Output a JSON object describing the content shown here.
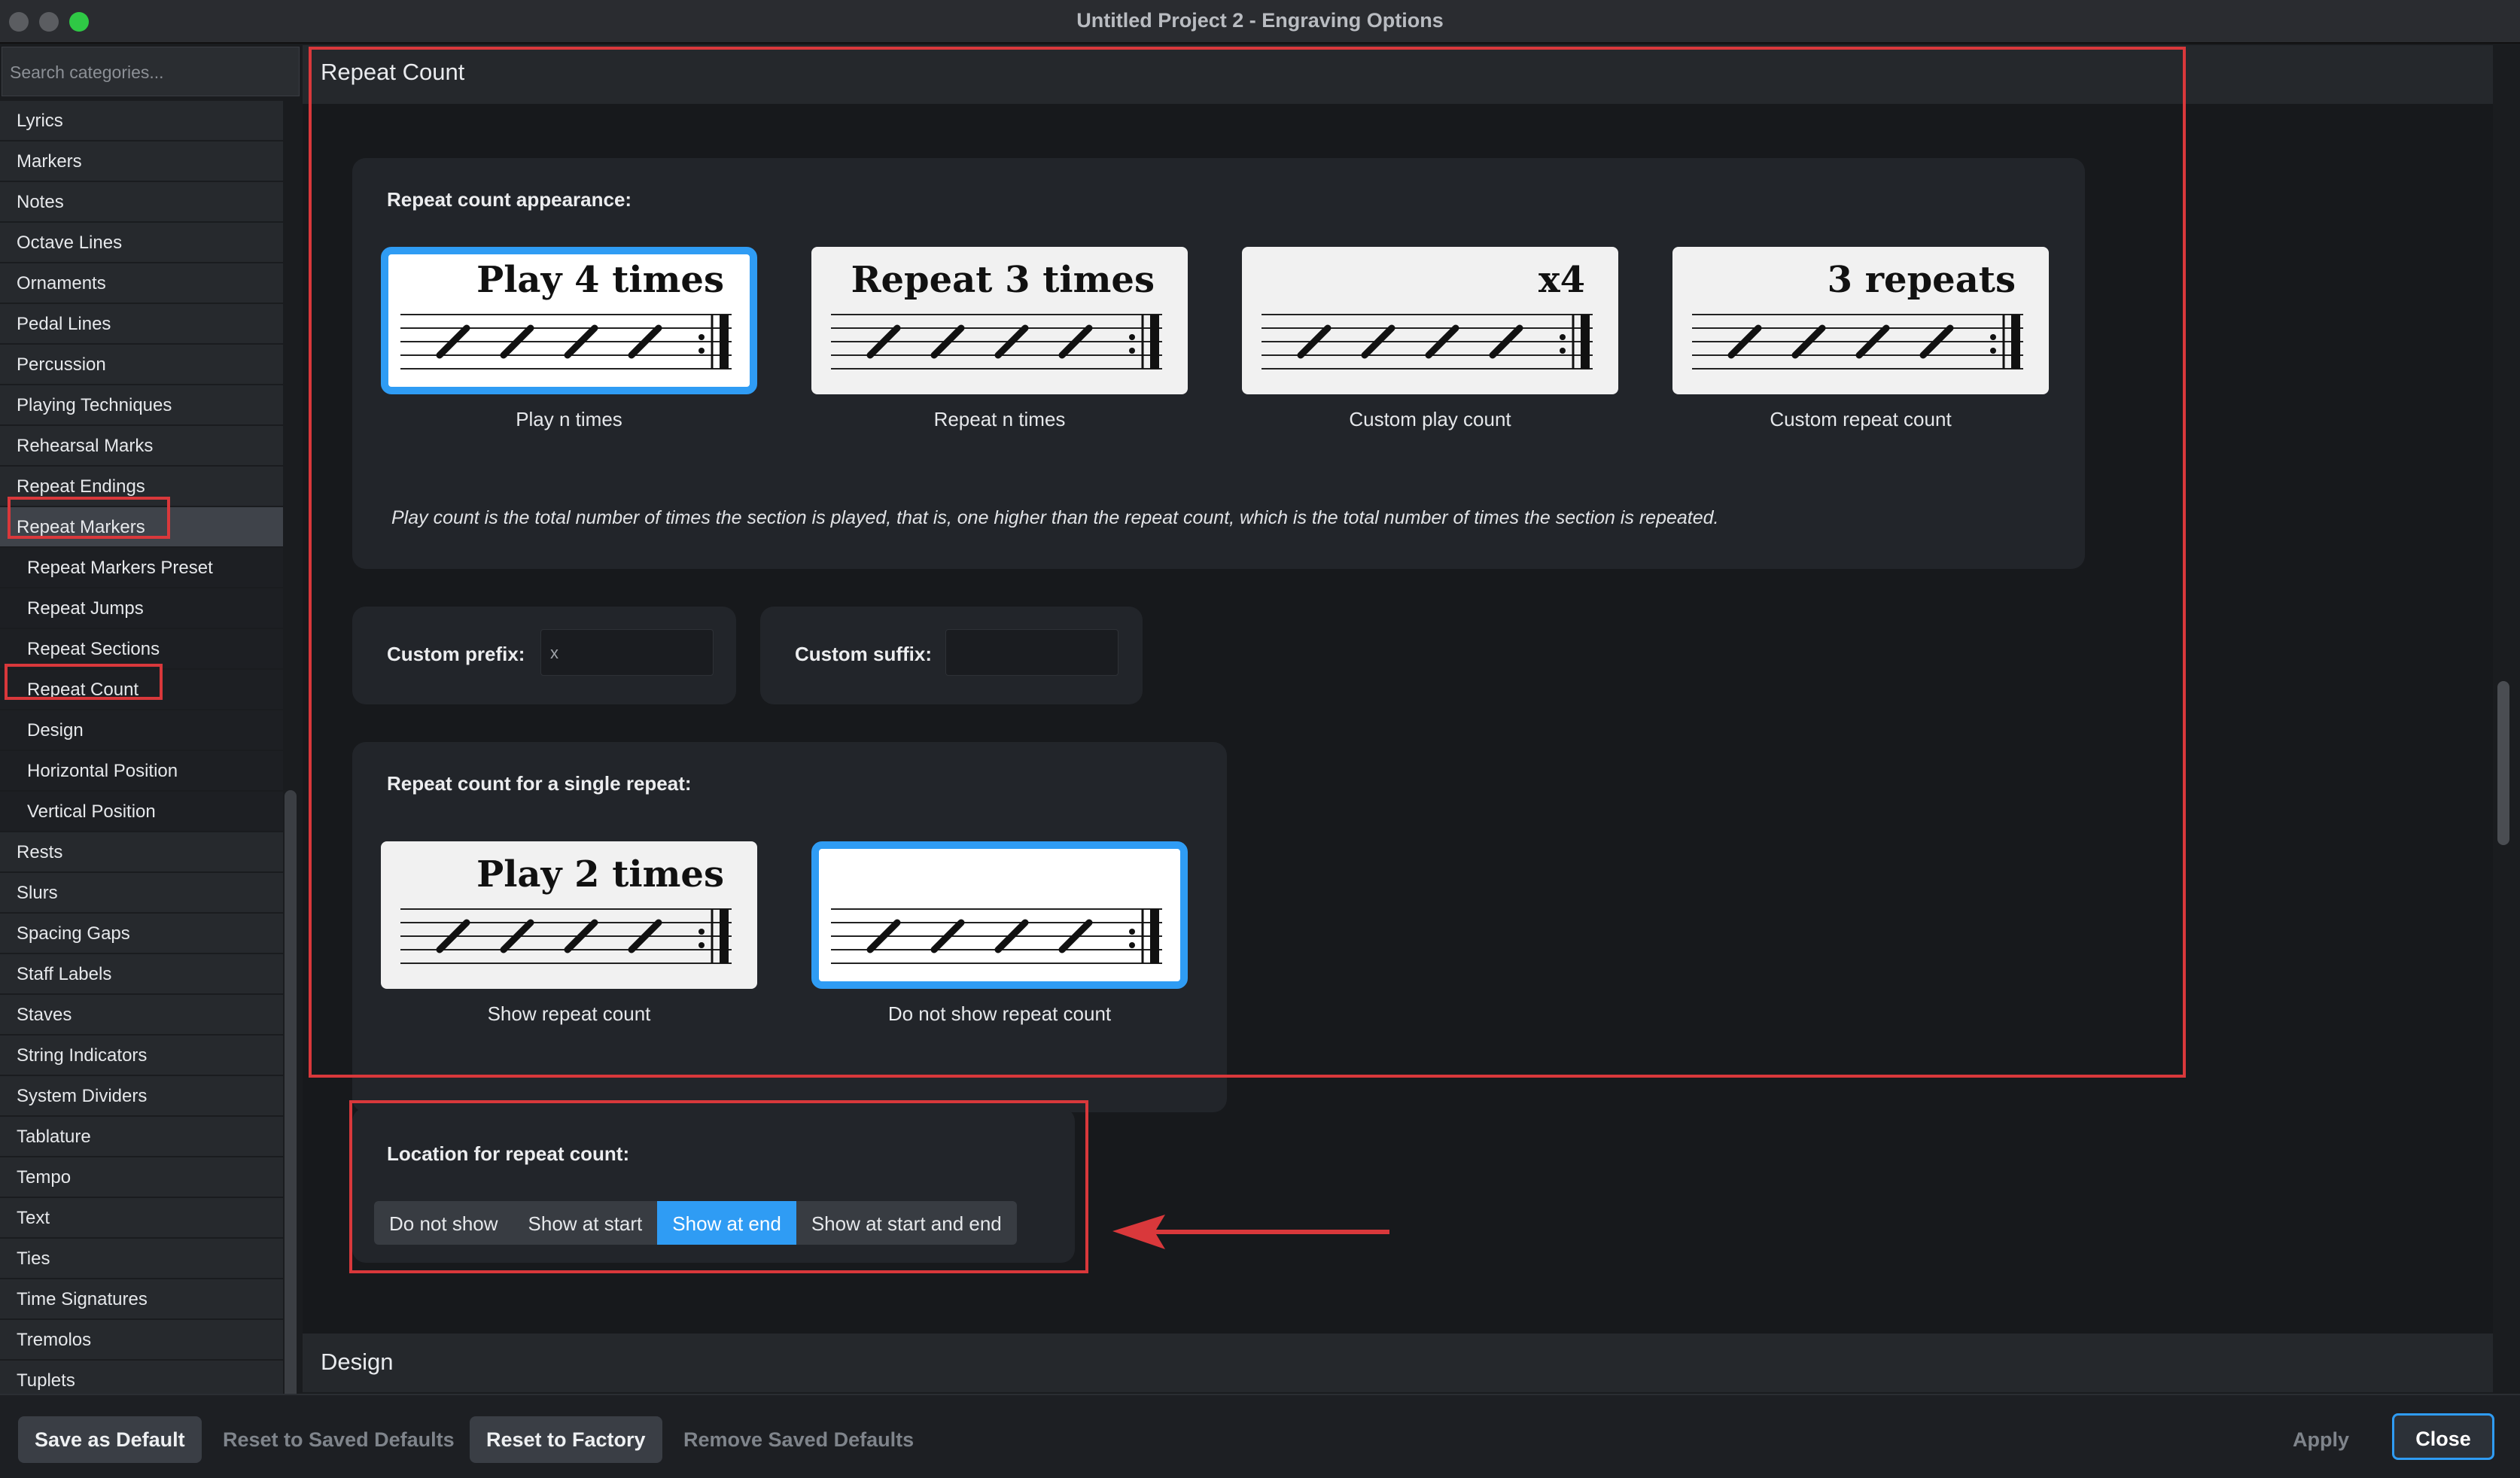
{
  "window": {
    "title": "Untitled Project 2 - Engraving Options",
    "accent_color": "#2f9cf4",
    "annotation_color": "#d9383b"
  },
  "sidebar": {
    "search_placeholder": "Search categories...",
    "items": [
      {
        "label": "Lyrics",
        "level": 0
      },
      {
        "label": "Markers",
        "level": 0
      },
      {
        "label": "Notes",
        "level": 0
      },
      {
        "label": "Octave Lines",
        "level": 0
      },
      {
        "label": "Ornaments",
        "level": 0
      },
      {
        "label": "Pedal Lines",
        "level": 0
      },
      {
        "label": "Percussion",
        "level": 0
      },
      {
        "label": "Playing Techniques",
        "level": 0
      },
      {
        "label": "Rehearsal Marks",
        "level": 0
      },
      {
        "label": "Repeat Endings",
        "level": 0
      },
      {
        "label": "Repeat Markers",
        "level": 0,
        "active": true
      },
      {
        "label": "Repeat Markers Preset",
        "level": 1
      },
      {
        "label": "Repeat Jumps",
        "level": 1
      },
      {
        "label": "Repeat Sections",
        "level": 1
      },
      {
        "label": "Repeat Count",
        "level": 1
      },
      {
        "label": "Design",
        "level": 1
      },
      {
        "label": "Horizontal Position",
        "level": 1
      },
      {
        "label": "Vertical Position",
        "level": 1
      },
      {
        "label": "Rests",
        "level": 0
      },
      {
        "label": "Slurs",
        "level": 0
      },
      {
        "label": "Spacing Gaps",
        "level": 0
      },
      {
        "label": "Staff Labels",
        "level": 0
      },
      {
        "label": "Staves",
        "level": 0
      },
      {
        "label": "String Indicators",
        "level": 0
      },
      {
        "label": "System Dividers",
        "level": 0
      },
      {
        "label": "Tablature",
        "level": 0
      },
      {
        "label": "Tempo",
        "level": 0
      },
      {
        "label": "Text",
        "level": 0
      },
      {
        "label": "Ties",
        "level": 0
      },
      {
        "label": "Time Signatures",
        "level": 0
      },
      {
        "label": "Tremolos",
        "level": 0
      },
      {
        "label": "Tuplets",
        "level": 0
      }
    ]
  },
  "main": {
    "section_title": "Repeat Count",
    "appearance": {
      "label": "Repeat count appearance:",
      "options": [
        {
          "preview": "Play 4 times",
          "caption": "Play n times",
          "selected": true
        },
        {
          "preview": "Repeat 3 times",
          "caption": "Repeat n times",
          "selected": false
        },
        {
          "preview": "x4",
          "caption": "Custom play count",
          "selected": false
        },
        {
          "preview": "3 repeats",
          "caption": "Custom repeat count",
          "selected": false
        }
      ],
      "note": "Play count is the total number of times the section is played, that is, one higher than the repeat count, which is the total number of times the section is repeated."
    },
    "custom_prefix": {
      "label": "Custom prefix:",
      "value": "x"
    },
    "custom_suffix": {
      "label": "Custom suffix:",
      "value": ""
    },
    "single_repeat": {
      "label": "Repeat count for a single repeat:",
      "options": [
        {
          "preview": "Play 2 times",
          "caption": "Show repeat count",
          "selected": false
        },
        {
          "preview": "",
          "caption": "Do not show repeat count",
          "selected": true
        }
      ]
    },
    "location": {
      "label": "Location for repeat count:",
      "options": [
        "Do not show",
        "Show at start",
        "Show at end",
        "Show at start and end"
      ],
      "selected": "Show at end"
    },
    "next_section_title": "Design"
  },
  "footer": {
    "save_as_default": "Save as Default",
    "reset_to_saved": "Reset to Saved Defaults",
    "reset_to_factory": "Reset to Factory",
    "remove_saved": "Remove Saved Defaults",
    "apply": "Apply",
    "close": "Close"
  }
}
